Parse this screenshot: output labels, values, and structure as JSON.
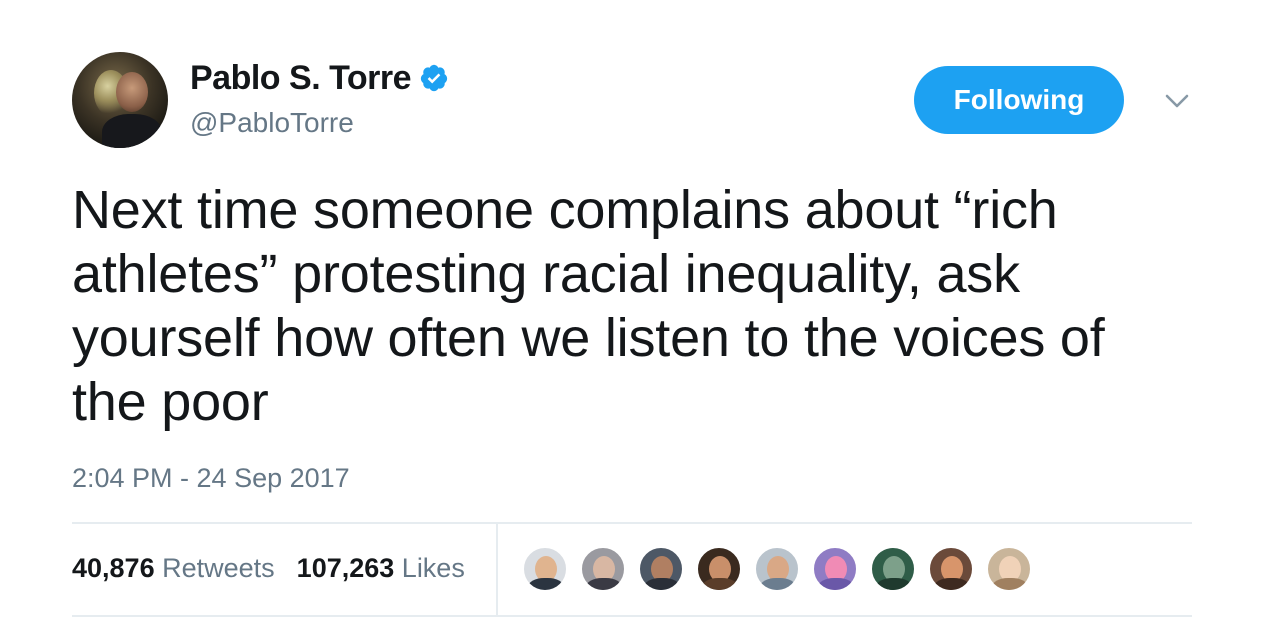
{
  "author": {
    "display_name": "Pablo S. Torre",
    "handle": "@PabloTorre",
    "verified": true
  },
  "follow_button": {
    "label": "Following"
  },
  "tweet": {
    "text": "Next time someone complains about “rich athletes” protesting racial inequality, ask yourself how often we listen to the voices of the poor",
    "timestamp": "2:04 PM - 24 Sep 2017"
  },
  "stats": {
    "retweets_count": "40,876",
    "retweets_label": "Retweets",
    "likes_count": "107,263",
    "likes_label": "Likes"
  },
  "likers": [
    {
      "bg": "#d9dde2",
      "face": "#e0b48f",
      "body": "#2b3440"
    },
    {
      "bg": "#9a9aa0",
      "face": "#d8b7a3",
      "body": "#3a3a44"
    },
    {
      "bg": "#4d5866",
      "face": "#b07f62",
      "body": "#2a2f38"
    },
    {
      "bg": "#3a2a1f",
      "face": "#c98f6a",
      "body": "#5a3d2a"
    },
    {
      "bg": "#b9c3cc",
      "face": "#d9a886",
      "body": "#6b7d8f"
    },
    {
      "bg": "#8f7cc4",
      "face": "#f08bb5",
      "body": "#6a58a8"
    },
    {
      "bg": "#2f5d48",
      "face": "#7da08a",
      "body": "#1f3a2e"
    },
    {
      "bg": "#6b4a3a",
      "face": "#d8956b",
      "body": "#3e2a20"
    },
    {
      "bg": "#c9b59a",
      "face": "#f0d2b8",
      "body": "#a08060"
    }
  ],
  "colors": {
    "accent": "#1da1f2",
    "secondary_text": "#657786",
    "primary_text": "#14171a"
  }
}
